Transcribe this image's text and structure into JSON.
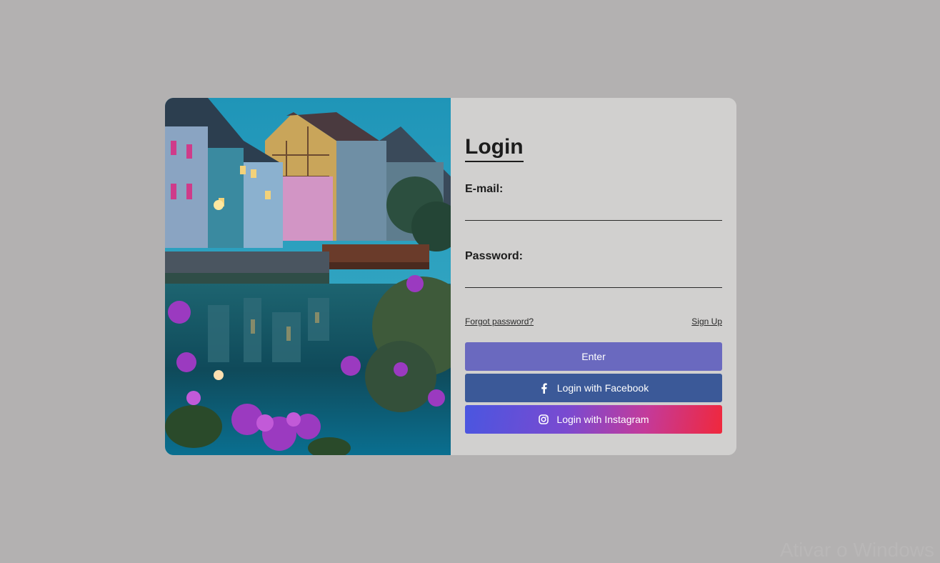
{
  "login": {
    "title": "Login",
    "email_label": "E-mail:",
    "email_value": "",
    "password_label": "Password:",
    "password_value": "",
    "forgot_password": "Forgot password?",
    "sign_up": "Sign Up",
    "enter_button": "Enter",
    "facebook_button": "Login with Facebook",
    "instagram_button": "Login with Instagram"
  },
  "icons": {
    "facebook": "facebook-icon",
    "instagram": "instagram-icon"
  },
  "colors": {
    "page_background": "#b3b1b1",
    "panel_background": "#d1d0cf",
    "enter": "#6a69bf",
    "facebook": "#3b5998",
    "instagram_start": "#4a56e0",
    "instagram_end": "#f0283c"
  },
  "watermark": "Ativar o Windows"
}
